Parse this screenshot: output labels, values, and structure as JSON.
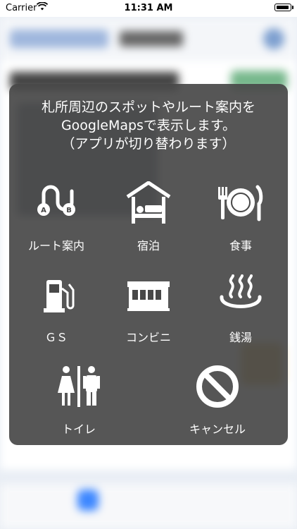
{
  "status_bar": {
    "carrier": "Carrier",
    "time": "11:31 AM",
    "battery_level": 0.95
  },
  "dialog": {
    "message_lines": [
      "札所周辺のスポットやルート案内を",
      "GoogleMapsで表示します。",
      "（アプリが切り替わります）"
    ],
    "options": [
      {
        "label": "ルート案内",
        "icon": "route-ab-icon"
      },
      {
        "label": "宿泊",
        "icon": "lodging-bed-icon"
      },
      {
        "label": "食事",
        "icon": "dining-plate-icon"
      },
      {
        "label": "ＧＳ",
        "icon": "gas-station-icon"
      },
      {
        "label": "コンビニ",
        "icon": "convenience-store-icon"
      },
      {
        "label": "銭湯",
        "icon": "hot-spring-icon"
      },
      {
        "label": "トイレ",
        "icon": "restroom-icon"
      },
      {
        "label": "キャンセル",
        "icon": "cancel-icon"
      }
    ]
  }
}
